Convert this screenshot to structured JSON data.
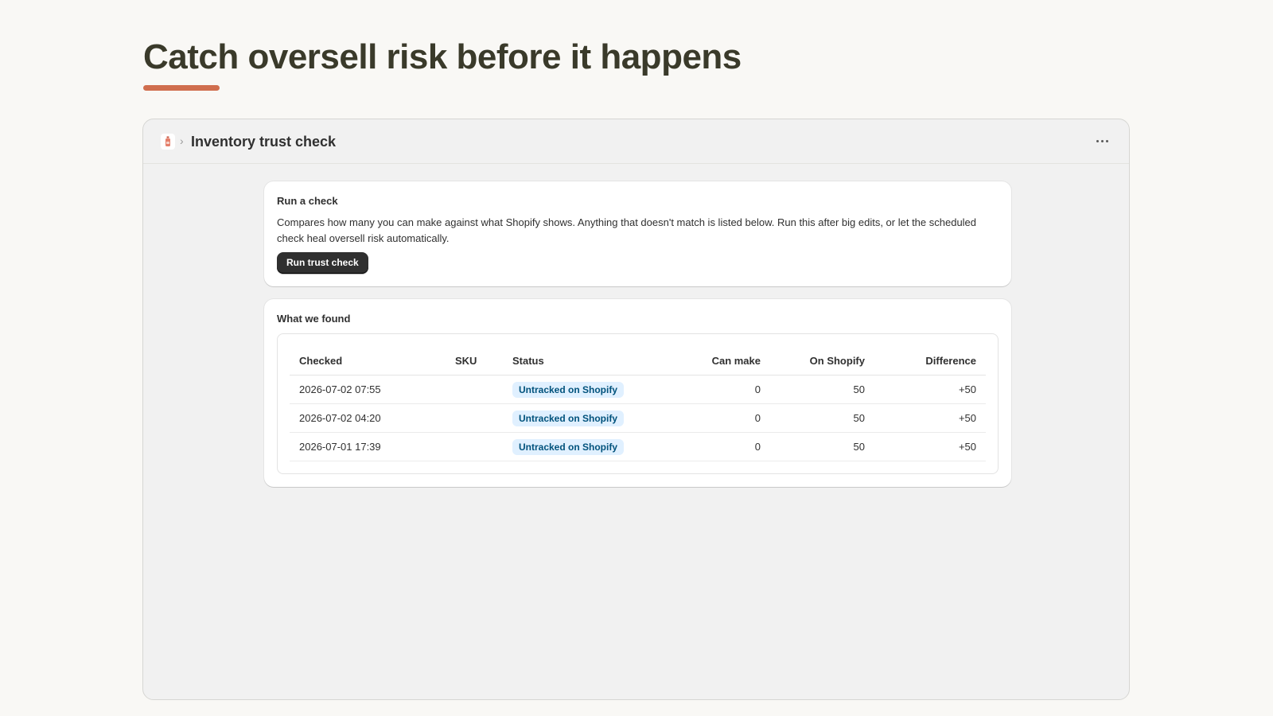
{
  "headline": {
    "text": "Catch oversell risk before it happens",
    "accent_color": "#d06e4e"
  },
  "window": {
    "app_icon": "bottle-icon",
    "breadcrumb_separator": "›",
    "title": "Inventory trust check",
    "menu_icon": "more-horizontal-icon"
  },
  "run_card": {
    "title": "Run a check",
    "description": "Compares how many you can make against what Shopify shows. Anything that doesn't match is listed below. Run this after big edits, or let the scheduled check heal oversell risk automatically.",
    "button_label": "Run trust check"
  },
  "found_card": {
    "title": "What we found",
    "columns": {
      "checked": "Checked",
      "sku": "SKU",
      "status": "Status",
      "can_make": "Can make",
      "on_shopify": "On Shopify",
      "difference": "Difference"
    },
    "rows": [
      {
        "checked": "2026-07-02 07:55",
        "sku": "",
        "status": "Untracked on Shopify",
        "can_make": "0",
        "on_shopify": "50",
        "difference": "+50"
      },
      {
        "checked": "2026-07-02 04:20",
        "sku": "",
        "status": "Untracked on Shopify",
        "can_make": "0",
        "on_shopify": "50",
        "difference": "+50"
      },
      {
        "checked": "2026-07-01 17:39",
        "sku": "",
        "status": "Untracked on Shopify",
        "can_make": "0",
        "on_shopify": "50",
        "difference": "+50"
      }
    ],
    "status_badge_color": "#e0f0ff"
  }
}
